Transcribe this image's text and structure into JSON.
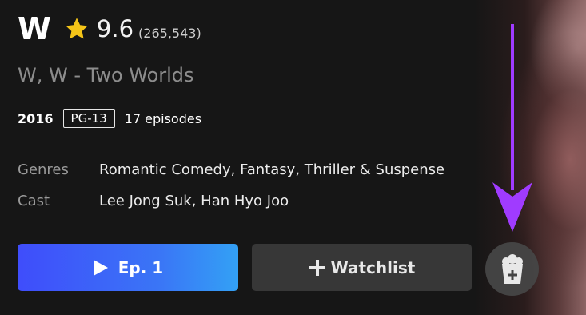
{
  "show": {
    "title": "W",
    "rating": "9.6",
    "votes": "(265,543)",
    "alt_titles": "W, W - Two Worlds"
  },
  "meta": {
    "year": "2016",
    "certificate": "PG-13",
    "episodes": "17 episodes"
  },
  "details": {
    "genres_label": "Genres",
    "genres_value": "Romantic Comedy, Fantasy, Thriller & Suspense",
    "cast_label": "Cast",
    "cast_value": "Lee Jong Suk, Han Hyo Joo"
  },
  "actions": {
    "play_label": "Ep. 1",
    "watchlist_label": "Watchlist"
  },
  "icons": {
    "star": "star-icon",
    "play": "play-icon",
    "plus": "plus-icon",
    "popcorn": "popcorn-bucket-icon",
    "annotation_arrow": "down-arrow-icon"
  },
  "colors": {
    "star": "#f5c518",
    "primary_button_start": "#3f4dfb",
    "primary_button_end": "#33a1f5",
    "annotation_arrow": "#a03bff"
  }
}
